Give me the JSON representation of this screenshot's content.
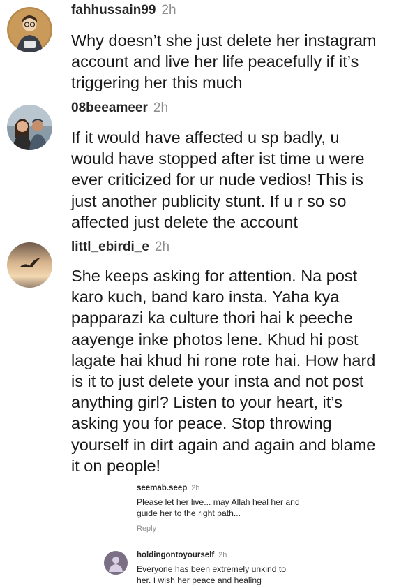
{
  "comments": [
    {
      "username": "fahhussain99",
      "time": "2h",
      "text": "Why doesn’t she just delete her instagram\naccount and live her life peacefully if it’s\ntriggering her this much"
    },
    {
      "username": "08beeameer",
      "time": "2h",
      "text": "If it would have affected u sp badly, u\nwould have stopped after ist time u were\never criticized for ur nude vedios! This is\njust another publicity stunt. If u r so so\naffected just delete the account"
    },
    {
      "username": "littl_ebirdi_e",
      "time": "2h",
      "text": "She keeps asking for attention. Na post\nkaro kuch, band karo insta. Yaha kya\npapparazi ka culture thori hai k peeche\naayenge inke photos lene. Khud hi post\nlagate hai khud hi rone rote hai. How hard\nis it to just delete your insta and not post\nanything girl? Listen to your heart, it’s\nasking you for peace. Stop throwing\nyourself in dirt again and again and blame\nit on people!"
    }
  ],
  "replies": [
    {
      "username": "seemab.seep",
      "time": "2h",
      "text": "Please let her live... may Allah heal her and\nguide her to the right path...",
      "reply_label": "Reply"
    },
    {
      "username": "holdingontoyourself",
      "time": "2h",
      "text": "Everyone has been extremely unkind to\nher. I wish her peace and healing"
    }
  ]
}
